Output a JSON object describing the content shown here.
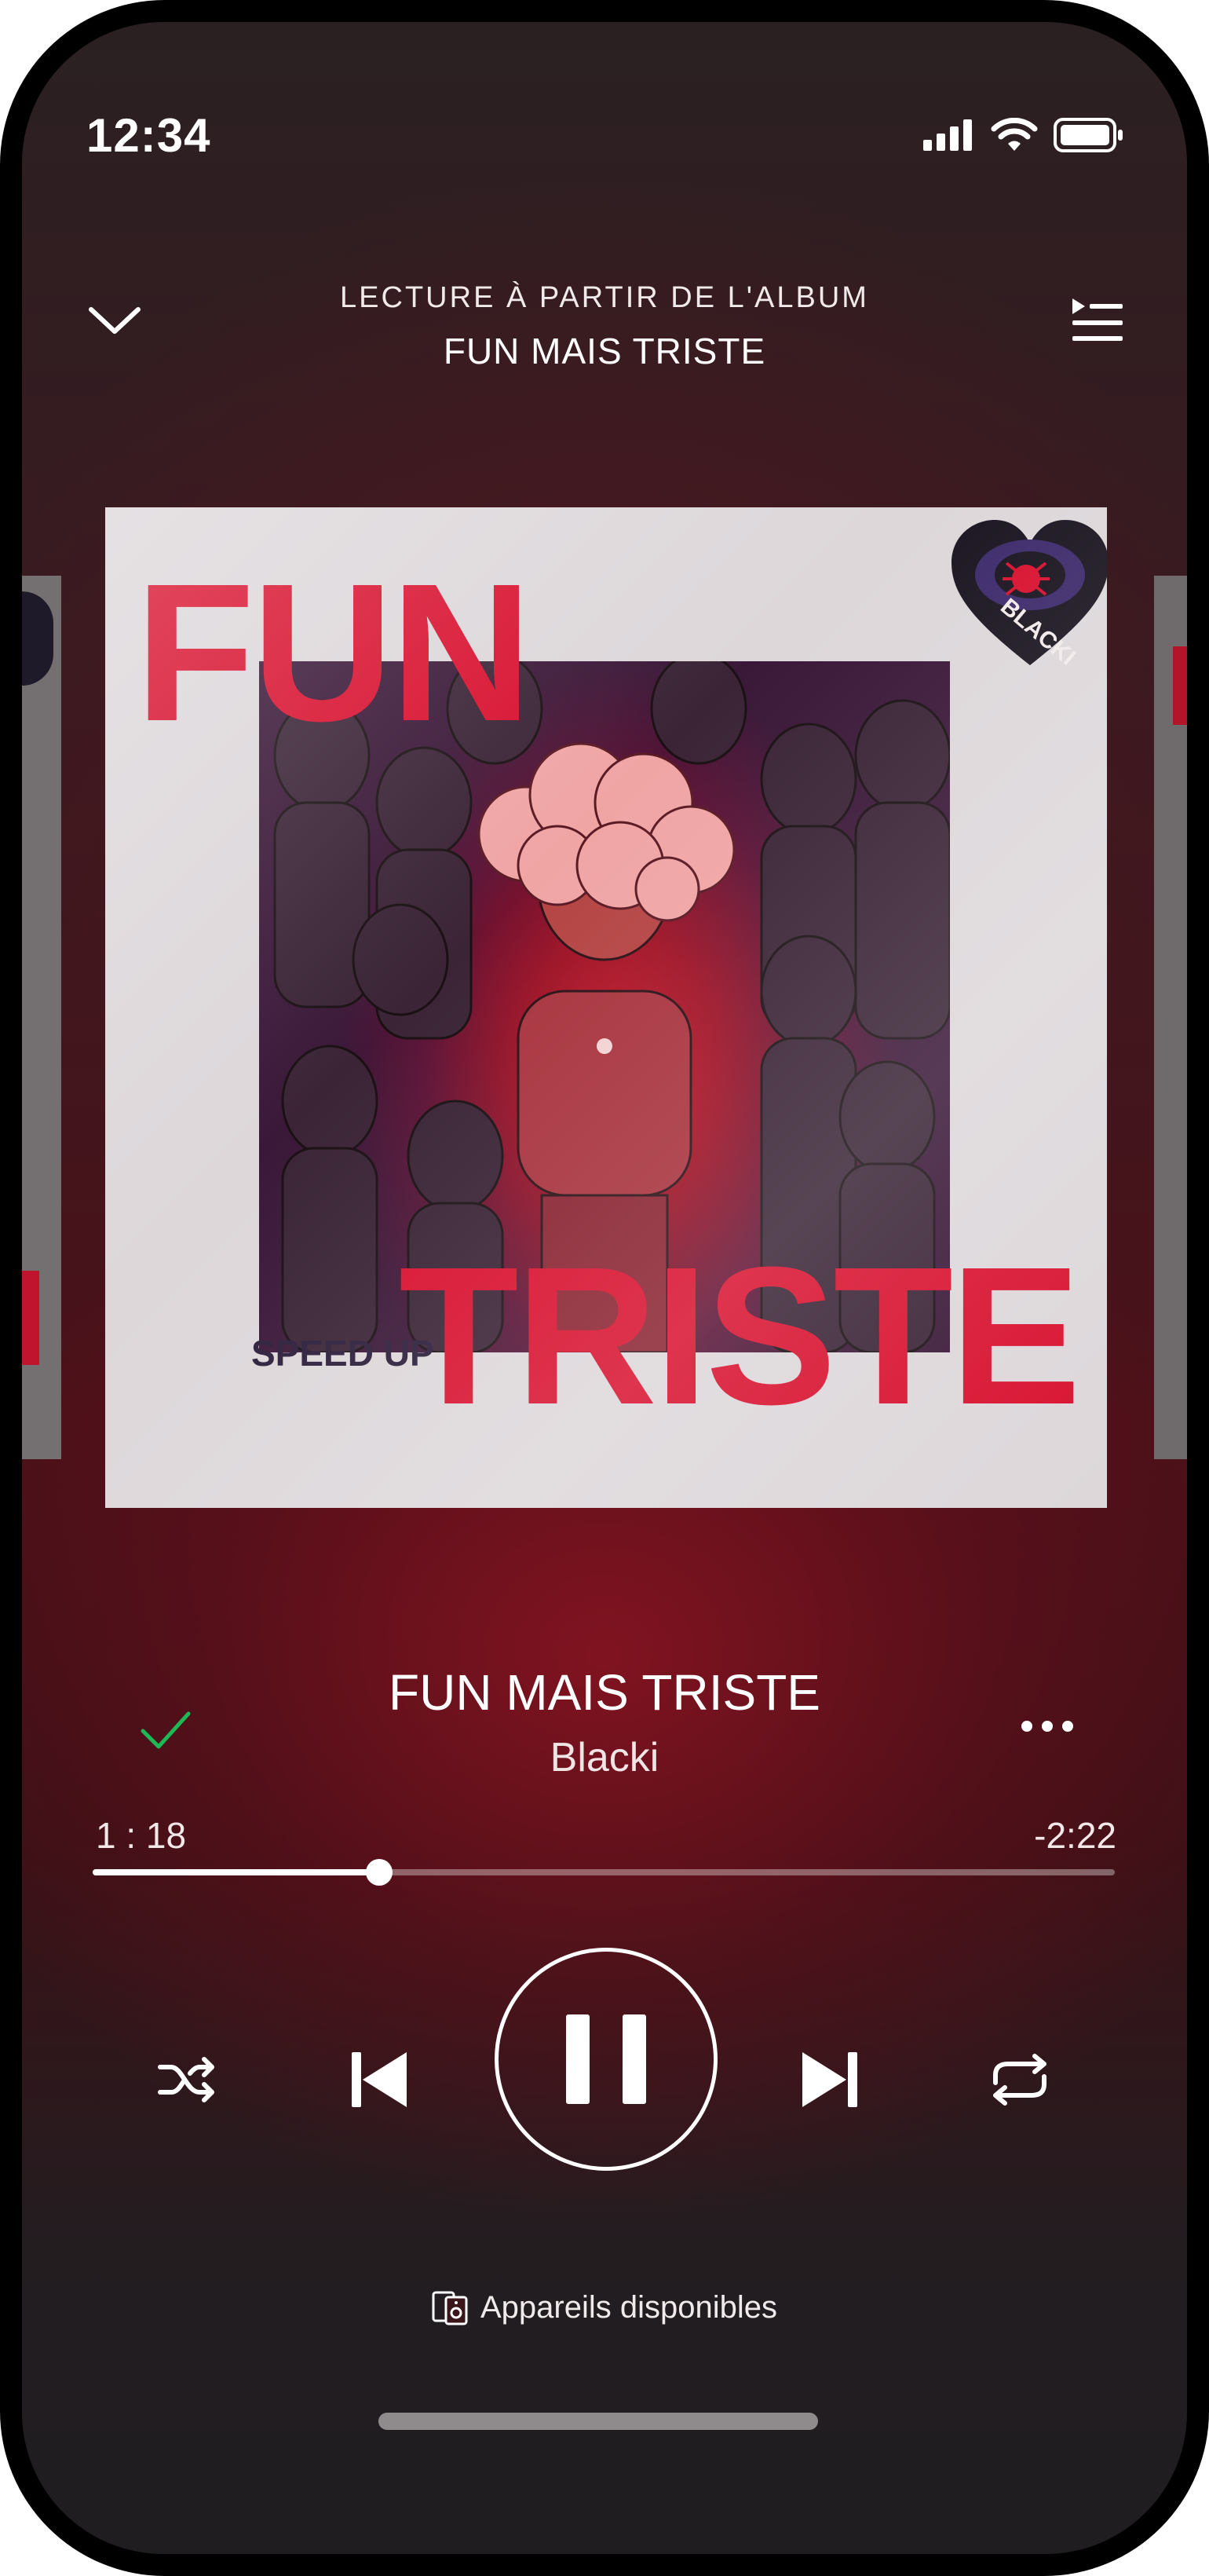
{
  "status_bar": {
    "time": "12:34",
    "icons": [
      "signal-icon",
      "wifi-icon",
      "battery-icon"
    ]
  },
  "header": {
    "context_label": "LECTURE À PARTIR DE L'ALBUM",
    "album_name": "FUN MAIS TRISTE",
    "icons": [
      "chevron-down-icon",
      "queue-icon"
    ]
  },
  "cover": {
    "title_top": "FUN",
    "title_bottom": "TRISTE",
    "tag": "SPEED UP",
    "logo_text": "BLACKI",
    "accent_color": "#d8112f"
  },
  "track": {
    "title": "FUN MAIS TRISTE",
    "artist": "Blacki",
    "liked": true
  },
  "playback": {
    "elapsed": "1 : 18",
    "remaining": "-2:22",
    "progress_fraction": 0.28,
    "state": "playing"
  },
  "controls": {
    "icons": [
      "shuffle-icon",
      "previous-icon",
      "pause-icon",
      "next-icon",
      "repeat-icon"
    ]
  },
  "devices": {
    "label": "Appareils disponibles"
  },
  "colors": {
    "background_accent": "#4a1119",
    "like_green": "#1db954"
  }
}
